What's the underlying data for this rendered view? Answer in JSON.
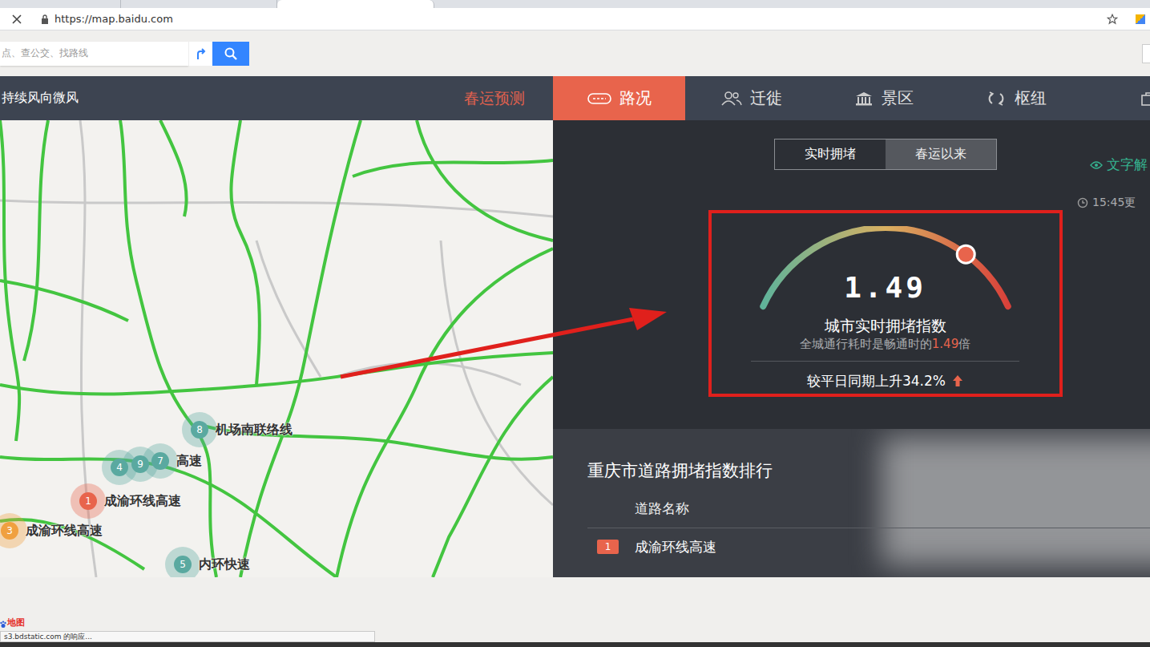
{
  "browser": {
    "url": "https://map.baidu.com"
  },
  "search": {
    "placeholder": "点、查公交、找路线"
  },
  "nav": {
    "weather": "持续风向微风",
    "promo": "春运预测",
    "tabs": [
      {
        "label": "路况",
        "selected": true
      },
      {
        "label": "迁徙",
        "selected": false
      },
      {
        "label": "景区",
        "selected": false
      },
      {
        "label": "枢纽",
        "selected": false
      }
    ]
  },
  "map": {
    "pins": [
      {
        "number": "8",
        "label": "机场南联络线",
        "color": "#5aa9a0"
      },
      {
        "number": "4",
        "label": "",
        "color": "#5aa9a0"
      },
      {
        "number": "9",
        "label": "",
        "color": "#5aa9a0"
      },
      {
        "number": "7",
        "label": "高速",
        "color": "#5aa9a0"
      },
      {
        "number": "1",
        "label": "成渝环线高速",
        "color": "#e8644c"
      },
      {
        "number": "3",
        "label": "成渝环线高速",
        "color": "#f0a040"
      },
      {
        "number": "5",
        "label": "内环快速",
        "color": "#5aa9a0"
      }
    ],
    "logo": "地图"
  },
  "panel": {
    "modes": [
      {
        "label": "实时拥堵",
        "selected": true
      },
      {
        "label": "春运以来",
        "selected": false
      }
    ],
    "text_toggle": "文字解",
    "time": "15:45更",
    "gauge": {
      "value": "1.49",
      "level": 0.78,
      "title": "城市实时拥堵指数",
      "subtitle_prefix": "全城通行耗时是畅通时的",
      "subtitle_value": "1.49",
      "subtitle_suffix": "倍",
      "change": "较平日同期上升34.2%",
      "trend": "up"
    }
  },
  "ranking": {
    "title": "重庆市道路拥堵指数排行",
    "columns": [
      "道路名称"
    ],
    "rows": [
      {
        "rank": "1",
        "name": "成渝环线高速"
      }
    ]
  },
  "status_bar": "s3.bdstatic.com 的响应..."
}
